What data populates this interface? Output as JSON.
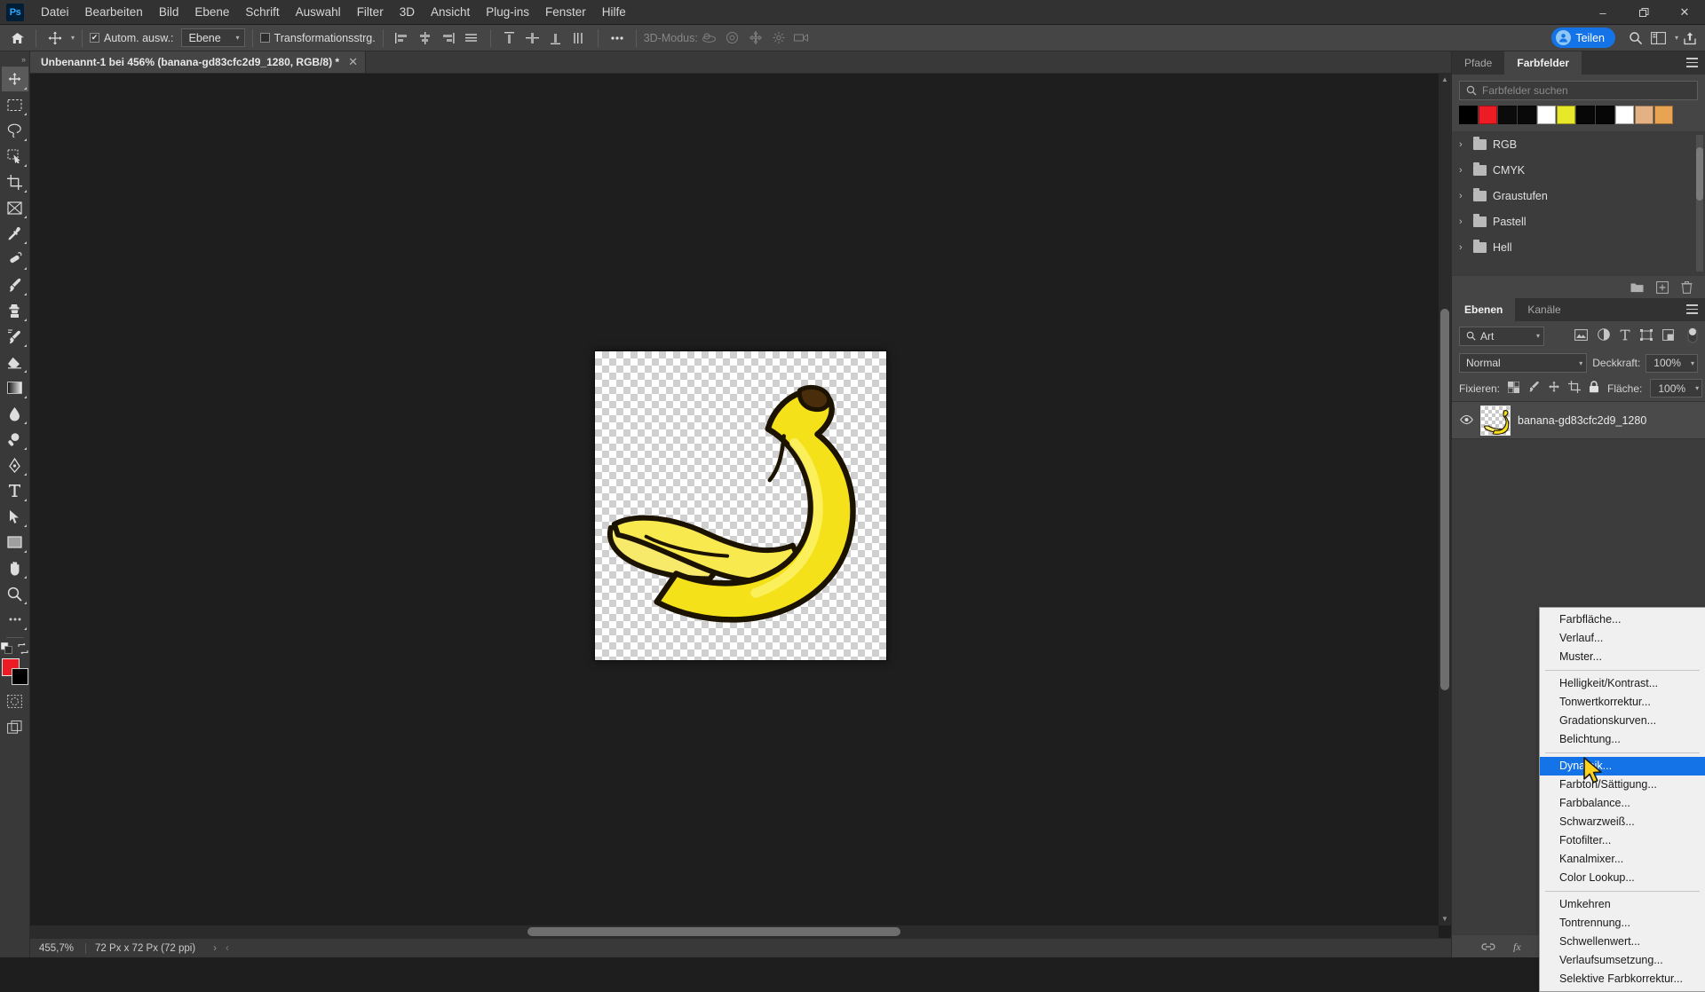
{
  "app": {
    "logo": "Ps"
  },
  "menubar": {
    "items": [
      {
        "label": "Datei"
      },
      {
        "label": "Bearbeiten"
      },
      {
        "label": "Bild"
      },
      {
        "label": "Ebene"
      },
      {
        "label": "Schrift"
      },
      {
        "label": "Auswahl"
      },
      {
        "label": "Filter"
      },
      {
        "label": "3D"
      },
      {
        "label": "Ansicht"
      },
      {
        "label": "Plug-ins"
      },
      {
        "label": "Fenster"
      },
      {
        "label": "Hilfe"
      }
    ]
  },
  "window_controls": {
    "minimize": "–",
    "maximize": "❐",
    "close": "✕"
  },
  "options_bar": {
    "home_icon": "home-icon",
    "tool_icon": "move-tool-icon",
    "auto_select_label": "Autom. ausw.:",
    "auto_select_checked": true,
    "auto_select_value": "Ebene",
    "transform_controls_label": "Transformationsstrg.",
    "transform_controls_checked": false,
    "more_icon": "ellipsis-icon",
    "three_d_label": "3D-Modus:",
    "share_label": "Teilen",
    "search_icon": "search-icon",
    "workspace_icon": "workspace-icon",
    "share_export_icon": "share-export-icon"
  },
  "document": {
    "tab_title": "Unbenannt-1 bei 456% (banana-gd83cfc2d9_1280, RGB/8) *",
    "close_icon": "✕"
  },
  "status_bar": {
    "zoom": "455,7%",
    "dimensions": "72 Px x 72 Px (72 ppi)",
    "arrow_right": "›",
    "arrow_left": "‹"
  },
  "toolbar": {
    "tools": [
      {
        "name": "move-tool",
        "active": true
      },
      {
        "name": "marquee-tool",
        "active": false
      },
      {
        "name": "lasso-tool",
        "active": false
      },
      {
        "name": "quick-selection-tool",
        "active": false
      },
      {
        "name": "crop-tool",
        "active": false
      },
      {
        "name": "frame-tool",
        "active": false
      },
      {
        "name": "eyedropper-tool",
        "active": false
      },
      {
        "name": "healing-brush-tool",
        "active": false
      },
      {
        "name": "brush-tool",
        "active": false
      },
      {
        "name": "clone-stamp-tool",
        "active": false
      },
      {
        "name": "history-brush-tool",
        "active": false
      },
      {
        "name": "eraser-tool",
        "active": false
      },
      {
        "name": "gradient-tool",
        "active": false
      },
      {
        "name": "blur-tool",
        "active": false
      },
      {
        "name": "dodge-tool",
        "active": false
      },
      {
        "name": "pen-tool",
        "active": false
      },
      {
        "name": "type-tool",
        "active": false
      },
      {
        "name": "path-selection-tool",
        "active": false
      },
      {
        "name": "rectangle-tool",
        "active": false
      },
      {
        "name": "hand-tool",
        "active": false
      },
      {
        "name": "zoom-tool",
        "active": false
      },
      {
        "name": "edit-toolbar",
        "active": false
      }
    ],
    "foreground_color": "#ed1c24",
    "background_color": "#000000"
  },
  "swatches_panel": {
    "tabs": [
      {
        "label": "Pfade",
        "active": false
      },
      {
        "label": "Farbfelder",
        "active": true
      }
    ],
    "search_placeholder": "Farbfelder suchen",
    "search_value": "",
    "swatches": [
      "#000000",
      "#ed1c24",
      "#0b0b0b",
      "#090909",
      "#ffffff",
      "#e8e82a",
      "#070707",
      "#060606",
      "#ffffff",
      "#e3b183",
      "#e8a353"
    ],
    "folders": [
      {
        "label": "RGB"
      },
      {
        "label": "CMYK"
      },
      {
        "label": "Graustufen"
      },
      {
        "label": "Pastell"
      },
      {
        "label": "Hell"
      }
    ],
    "footer_icons": [
      "new-folder-icon",
      "new-swatch-icon",
      "delete-swatch-icon"
    ]
  },
  "layers_panel": {
    "tabs": [
      {
        "label": "Ebenen",
        "active": true
      },
      {
        "label": "Kanäle",
        "active": false
      }
    ],
    "filter_label": "Art",
    "filter_icons": [
      "pixel-filter-icon",
      "adjustment-filter-icon",
      "type-filter-icon",
      "shape-filter-icon",
      "smart-object-filter-icon"
    ],
    "blend_mode": "Normal",
    "opacity_label": "Deckkraft:",
    "opacity_value": "100%",
    "lock_label": "Fixieren:",
    "fill_label": "Fläche:",
    "fill_value": "100%",
    "lock_icons": [
      "lock-transparent-icon",
      "lock-image-icon",
      "lock-position-icon",
      "lock-artboard-icon",
      "lock-all-icon"
    ],
    "layers": [
      {
        "name": "banana-gd83cfc2d9_1280",
        "visible": true,
        "selected": true
      }
    ],
    "footer_icons": [
      "link-icon",
      "fx-icon",
      "mask-icon",
      "adjustment-icon",
      "group-icon",
      "new-layer-icon",
      "delete-layer-icon"
    ]
  },
  "context_menu": {
    "groups": [
      [
        "Farbfläche...",
        "Verlauf...",
        "Muster..."
      ],
      [
        "Helligkeit/Kontrast...",
        "Tonwertkorrektur...",
        "Gradationskurven...",
        "Belichtung..."
      ],
      [
        "Dynamik...",
        "Farbton/Sättigung...",
        "Farbbalance...",
        "Schwarzweiß...",
        "Fotofilter...",
        "Kanalmixer...",
        "Color Lookup..."
      ],
      [
        "Umkehren",
        "Tontrennung...",
        "Schwellenwert...",
        "Verlaufsumsetzung...",
        "Selektive Farbkorrektur..."
      ]
    ],
    "selected": "Dynamik...",
    "highlight_color": "#1473e6"
  },
  "canvas": {
    "artwork": "banana-illustration",
    "banana_color": "#f5e119",
    "banana_highlight": "#fbf05a",
    "outline_color": "#1b1200",
    "stem_color": "#4a2d0a"
  }
}
